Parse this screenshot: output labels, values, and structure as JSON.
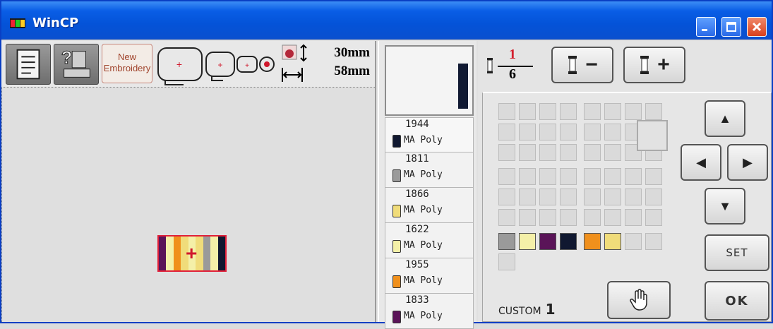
{
  "window": {
    "title": "WinCP"
  },
  "toolbar": {
    "new_embroidery_line1": "New",
    "new_embroidery_line2": "Embroidery",
    "height": "30mm",
    "width": "58mm"
  },
  "threads": [
    {
      "code": "1944",
      "brand": "MA",
      "type": "Poly",
      "color": "#101830"
    },
    {
      "code": "1811",
      "brand": "MA",
      "type": "Poly",
      "color": "#9a9a9a"
    },
    {
      "code": "1866",
      "brand": "MA",
      "type": "Poly",
      "color": "#f0dc7a"
    },
    {
      "code": "1622",
      "brand": "MA",
      "type": "Poly",
      "color": "#f4f0a8"
    },
    {
      "code": "1955",
      "brand": "MA",
      "type": "Poly",
      "color": "#f0901c"
    },
    {
      "code": "1833",
      "brand": "MA",
      "type": "Poly",
      "color": "#5a1458"
    }
  ],
  "design_stripes": [
    "#5a1458",
    "#f4f0a8",
    "#f0901c",
    "#f0dc7a",
    "#f4f0a8",
    "#f0dc7a",
    "#9a9a9a",
    "#f4f0a8",
    "#101830"
  ],
  "ratio": {
    "current": "1",
    "total": "6"
  },
  "controls": {
    "minus": "−",
    "plus": "+",
    "set": "SET",
    "ok": "OK",
    "custom_label": "CUSTOM",
    "custom_value": "1"
  },
  "palette": {
    "custom_colors": [
      "#9a9a9a",
      "#f4f0a8",
      "#5a1458",
      "#101830",
      "#f0901c",
      "#f0dc7a"
    ]
  }
}
